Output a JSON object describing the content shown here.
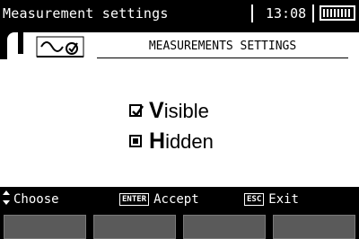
{
  "title_bar": {
    "title": "Measurement settings",
    "time": "13:08",
    "battery_icon": "battery-full-icon"
  },
  "tab": {
    "icon": "waveform-check-icon",
    "label": "MEASUREMENTS SETTINGS"
  },
  "options": [
    {
      "first": "V",
      "rest": "isible",
      "checked": true
    },
    {
      "first": "H",
      "rest": "idden",
      "checked": false
    }
  ],
  "hints": {
    "choose_icon": "up-down-arrows-icon",
    "choose": "Choose",
    "accept_key": "ENTER",
    "accept": "Accept",
    "exit_key": "ESC",
    "exit": "Exit"
  },
  "softkeys": [
    "",
    "",
    "",
    ""
  ]
}
